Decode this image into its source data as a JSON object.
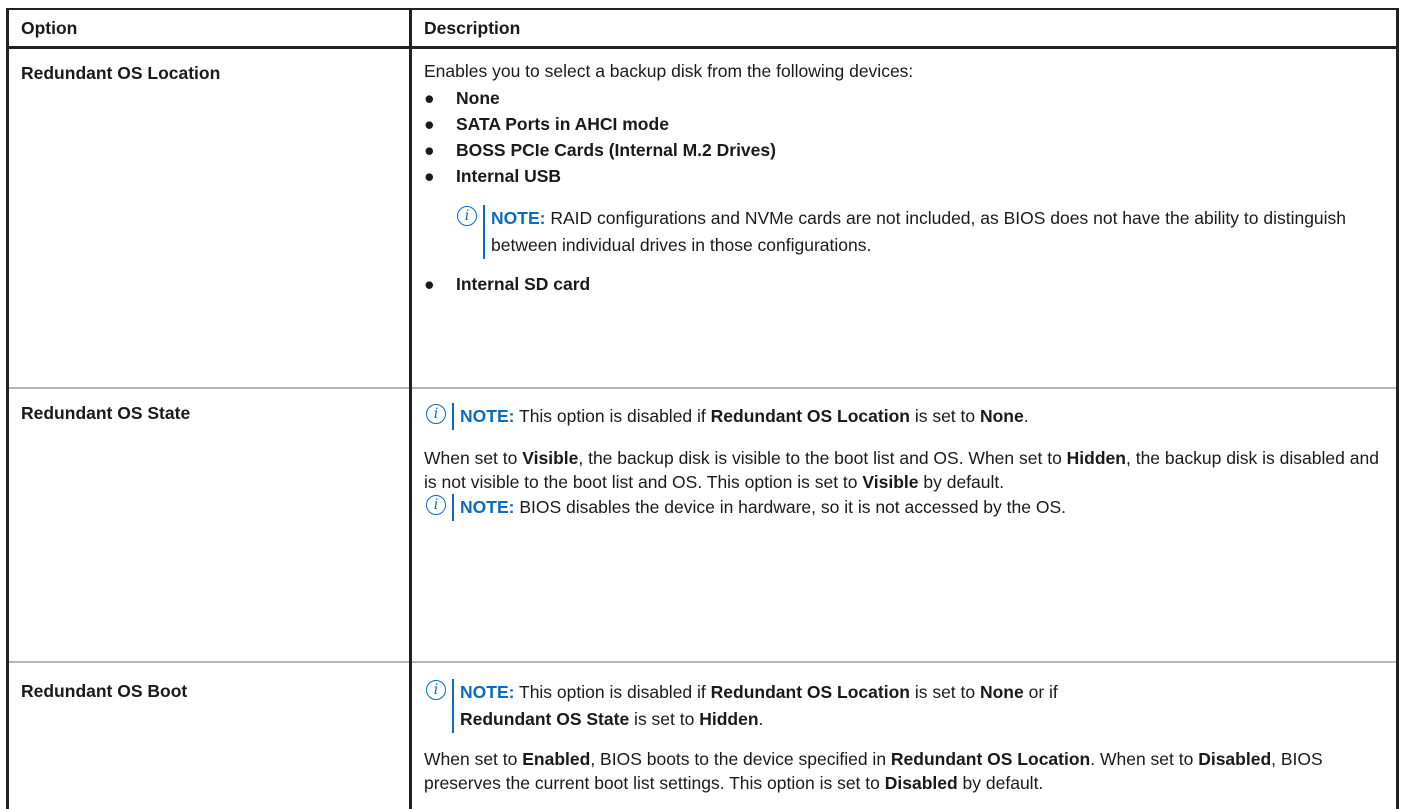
{
  "header": {
    "option": "Option",
    "description": "Description"
  },
  "rows": [
    {
      "option": "Redundant OS Location",
      "intro": "Enables you to select a backup disk from the following devices:",
      "bullets_top": [
        "None",
        "SATA Ports in AHCI mode",
        "BOSS PCIe Cards (Internal M.2 Drives)",
        "Internal USB"
      ],
      "note": {
        "lead": "NOTE:",
        "text": " RAID configurations and NVMe cards are not included, as BIOS does not have the ability to distinguish between individual drives in those configurations."
      },
      "bullets_bottom": [
        "Internal SD card"
      ]
    },
    {
      "option": "Redundant OS State",
      "note1": {
        "lead": "NOTE:",
        "t1": " This option is disabled if ",
        "b1": "Redundant OS Location",
        "t2": " is set to ",
        "b2": "None",
        "t3": "."
      },
      "para": {
        "t1": "When set to ",
        "b1": "Visible",
        "t2": ", the backup disk is visible to the boot list and OS. When set to ",
        "b2": "Hidden",
        "t3": ", the backup disk is disabled and is not visible to the boot list and OS. This option is set to ",
        "b3": "Visible",
        "t4": " by default."
      },
      "note2": {
        "lead": "NOTE:",
        "text": " BIOS disables the device in hardware, so it is not accessed by the OS."
      }
    },
    {
      "option": "Redundant OS Boot",
      "note1": {
        "lead": "NOTE:",
        "t1": " This option is disabled if ",
        "b1": "Redundant OS Location",
        "t2": " is set to ",
        "b2": "None",
        "t3": " or if ",
        "b3": "Redundant OS State",
        "t4": " is set to ",
        "b4": "Hidden",
        "t5": "."
      },
      "para": {
        "t1": "When set to ",
        "b1": "Enabled",
        "t2": ", BIOS boots to the device specified in ",
        "b2": "Redundant OS Location",
        "t3": ". When set to ",
        "b3": "Disabled",
        "t4": ", BIOS preserves the current boot list settings. This option is set to ",
        "b4": "Disabled",
        "t5": " by default."
      }
    }
  ],
  "icons": {
    "note_icon": "info-circle-icon",
    "note_glyph": "i"
  },
  "colors": {
    "note_accent": "#0a6bc4",
    "border": "#222222",
    "row_divider": "#b5b5b5"
  }
}
